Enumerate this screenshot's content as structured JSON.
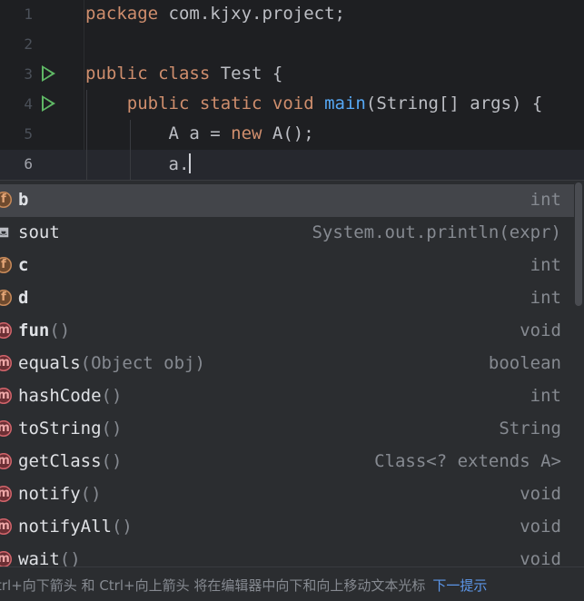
{
  "editor": {
    "lines": [
      {
        "num": "1",
        "tokens": [
          {
            "t": "package ",
            "c": "kw"
          },
          {
            "t": "com.kjxy.project;",
            "c": "var"
          }
        ]
      },
      {
        "num": "2",
        "tokens": []
      },
      {
        "num": "3",
        "run": true,
        "tokens": [
          {
            "t": "public class ",
            "c": "kw"
          },
          {
            "t": "Test {",
            "c": "var"
          }
        ]
      },
      {
        "num": "4",
        "run": true,
        "tokens": [
          {
            "t": "    public static void ",
            "c": "kw"
          },
          {
            "t": "main",
            "c": "fn"
          },
          {
            "t": "(String[] args) {",
            "c": "var"
          }
        ]
      },
      {
        "num": "5",
        "tokens": [
          {
            "t": "        A a = ",
            "c": "var"
          },
          {
            "t": "new ",
            "c": "kw"
          },
          {
            "t": "A();",
            "c": "var"
          }
        ]
      },
      {
        "num": "6",
        "current": true,
        "tokens": [
          {
            "t": "        a.",
            "c": "var"
          }
        ]
      }
    ]
  },
  "completion": {
    "items": [
      {
        "icon": "f",
        "name": "b",
        "params": "",
        "type": "int",
        "selected": true,
        "bold": true
      },
      {
        "icon": "t",
        "name": "sout",
        "params": "",
        "type": "System.out.println(expr)"
      },
      {
        "icon": "f",
        "name": "c",
        "params": "",
        "type": "int",
        "bold": true
      },
      {
        "icon": "f",
        "name": "d",
        "params": "",
        "type": "int",
        "bold": true
      },
      {
        "icon": "m",
        "name": "fun",
        "params": "()",
        "type": "void",
        "bold": true
      },
      {
        "icon": "m",
        "name": "equals",
        "params": "(Object obj)",
        "type": "boolean"
      },
      {
        "icon": "m",
        "name": "hashCode",
        "params": "()",
        "type": "int"
      },
      {
        "icon": "m",
        "name": "toString",
        "params": "()",
        "type": "String"
      },
      {
        "icon": "m",
        "name": "getClass",
        "params": "()",
        "type": "Class<? extends A>"
      },
      {
        "icon": "m",
        "name": "notify",
        "params": "()",
        "type": "void"
      },
      {
        "icon": "m",
        "name": "notifyAll",
        "params": "()",
        "type": "void"
      },
      {
        "icon": "m",
        "name": "wait",
        "params": "()",
        "type": "void"
      }
    ],
    "icon_letters": {
      "f": "f",
      "m": "m",
      "t": "⛾"
    }
  },
  "hint": {
    "text": "trl+向下箭头 和 Ctrl+向上箭头 将在编辑器中向下和向上移动文本光标",
    "link": "下一提示"
  },
  "colors": {
    "keyword": "#cf8e6d",
    "function": "#56a8f5",
    "link": "#5c96e8",
    "run": "#5fb865"
  }
}
